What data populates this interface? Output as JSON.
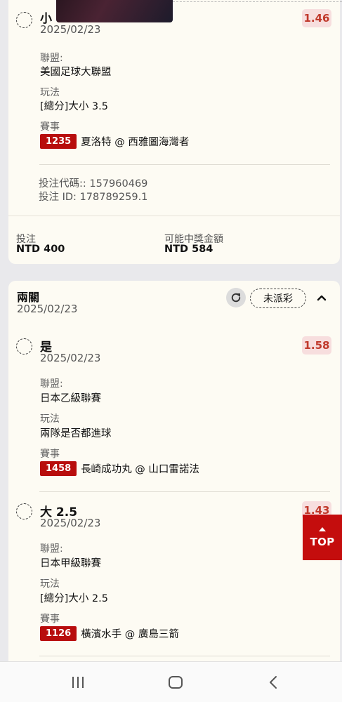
{
  "bet1": {
    "legs": [
      {
        "selection": "小",
        "date": "2025/02/23",
        "odds": "1.46",
        "league_label": "聯盟:",
        "league": "美國足球大聯盟",
        "market_label": "玩法",
        "market": "[總分]大小 3.5",
        "event_label": "賽事",
        "event_code": "1235",
        "event": "夏洛特 @ 西雅圖海灣者"
      }
    ],
    "bet_code_label": "投注代碼:: 157960469",
    "bet_id_label": "投注 ID: 178789259.1",
    "stake_label": "投注",
    "stake": "NTD 400",
    "payout_label": "可能中獎金額",
    "payout": "NTD 584"
  },
  "bet2": {
    "title": "兩關",
    "date": "2025/02/23",
    "status": "未派彩",
    "legs": [
      {
        "selection": "是",
        "date": "2025/02/23",
        "odds": "1.58",
        "league_label": "聯盟:",
        "league": "日本乙級聯賽",
        "market_label": "玩法",
        "market": "兩隊是否都進球",
        "event_label": "賽事",
        "event_code": "1458",
        "event": "長崎成功丸 @ 山口雷諾法"
      },
      {
        "selection": "大 2.5",
        "date": "2025/02/23",
        "odds": "1.43",
        "league_label": "聯盟:",
        "league": "日本甲級聯賽",
        "market_label": "玩法",
        "market": "[總分]大小 2.5",
        "event_label": "賽事",
        "event_code": "1126",
        "event": "橫濱水手 @ 廣島三箭"
      }
    ]
  },
  "top_button": {
    "label": "TOP"
  },
  "icons": {
    "refresh": "refresh-icon",
    "chevron": "chevron-up-icon",
    "nav_recent": "recent-apps-icon",
    "nav_home": "home-icon",
    "nav_back": "back-icon"
  },
  "colors": {
    "accent_red": "#c40d0d",
    "event_code_bg": "#b80d0d",
    "odds_text": "#c0392b",
    "odds_bg": "#f7dede",
    "card_bg": "#fdfbf3",
    "page_bg": "#e9e9ec"
  }
}
